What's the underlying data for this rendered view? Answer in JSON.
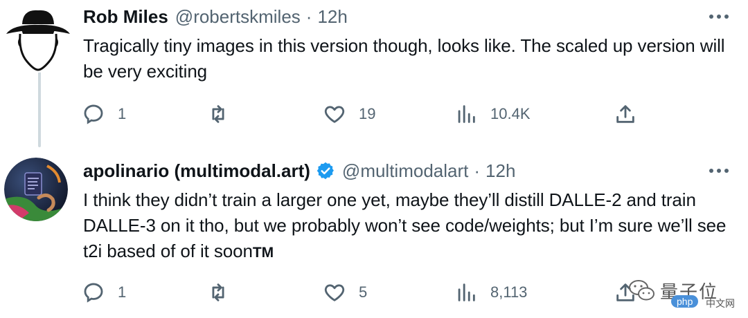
{
  "tweets": [
    {
      "author_name": "Rob Miles",
      "handle": "@robertskmiles",
      "separator": "·",
      "time": "12h",
      "text": "Tragically tiny images in this version though, looks like. The scaled up version will be very exciting",
      "replies": "1",
      "retweets": "",
      "likes": "19",
      "views": "10.4K"
    },
    {
      "author_name": "apolinario (multimodal.art)",
      "verified": true,
      "handle": "@multimodalart",
      "separator": "·",
      "time": "12h",
      "text": "I think they didn’t train a larger one yet, maybe they’ll distill DALLE-2 and train DALLE-3 on it tho, but we probably won’t see code/weights; but I’m sure we’ll see t2i based of of it soon",
      "text_suffix": "TM",
      "replies": "1",
      "retweets": "",
      "likes": "5",
      "views": "8,113"
    }
  ],
  "watermark": {
    "brand": "量子位",
    "badge": "php",
    "site": "中文网"
  },
  "colors": {
    "text": "#0f1419",
    "secondary": "#536471",
    "verified": "#1d9bf0",
    "thread_line": "#cfd9de"
  },
  "icons": {
    "more": "more-dots-icon",
    "reply": "reply-bubble-icon",
    "retweet": "retweet-arrows-icon",
    "like": "heart-icon",
    "views": "analytics-bars-icon",
    "share": "share-upload-icon"
  }
}
